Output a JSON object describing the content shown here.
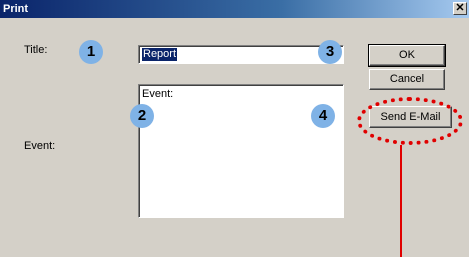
{
  "window": {
    "title": "Print",
    "close_glyph": "✕"
  },
  "form": {
    "title_label": "Title:",
    "title_value": "Report",
    "event_label": "Event:",
    "event_value": "Event:"
  },
  "buttons": {
    "ok": "OK",
    "cancel": "Cancel",
    "send_email": "Send E-Mail"
  },
  "annotations": {
    "badges": [
      "1",
      "2",
      "3",
      "4"
    ],
    "highlight_color": "#e00000",
    "badge_color": "#7fb2e6"
  }
}
